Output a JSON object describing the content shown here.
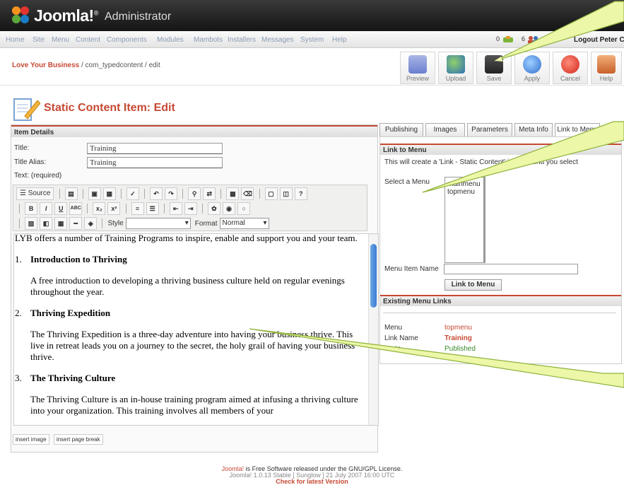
{
  "header": {
    "brand": "Joomla!",
    "sup": "®",
    "admin": "Administrator"
  },
  "menu": [
    "Home",
    "Site",
    "Menu",
    "Content",
    "Components",
    "Modules",
    "Mambots",
    "Installers",
    "Messages",
    "System",
    "Help"
  ],
  "status": {
    "messages": "0",
    "users": "6",
    "logout": "Logout Peter Coo"
  },
  "breadcrumb": {
    "site": "Love Your Business",
    "path": " / com_typedcontent / edit"
  },
  "toolbar": [
    "Preview",
    "Upload",
    "Save",
    "Apply",
    "Cancel",
    "Help"
  ],
  "page": {
    "title": "Static Content Item: Edit"
  },
  "details": {
    "heading": "Item Details",
    "title_label": "Title:",
    "title_value": "Training",
    "alias_label": "Title Alias:",
    "alias_value": "Training",
    "text_label": "Text: (required)"
  },
  "editor_toolbar": {
    "source": "Source",
    "style_label": "Style",
    "format_label": "Format",
    "format_value": "Normal"
  },
  "content": {
    "intro": "LYB offers a number of Training Programs to inspire, enable and support you and your team.",
    "items": [
      {
        "num": "1.",
        "title": "Introduction to Thriving",
        "desc": "A free introduction to developing a thriving business culture held on regular evenings throughout the year."
      },
      {
        "num": "2.",
        "title": "Thriving Expedition",
        "desc": "The Thriving Expedition is a three-day adventure into having your business thrive. This live in retreat leads you on a journey to the secret, the holy grail of having your business thrive."
      },
      {
        "num": "3.",
        "title": "The Thriving Culture",
        "desc": "The Thriving Culture is an in-house training program aimed at infusing a thriving culture into your organization. This training involves all members of your"
      }
    ]
  },
  "insert": {
    "image": "insert image",
    "pagebreak": "insert page break"
  },
  "tabs": [
    "Publishing",
    "Images",
    "Parameters",
    "Meta Info",
    "Link to Menu"
  ],
  "link_menu": {
    "heading": "Link to Menu",
    "desc": "This will create a 'Link - Static Content' in the menu you select",
    "select_label": "Select a Menu",
    "options": [
      "mainmenu",
      "topmenu"
    ],
    "name_label": "Menu Item Name",
    "button": "Link to Menu"
  },
  "existing": {
    "heading": "Existing Menu Links",
    "menu_label": "Menu",
    "menu_value": "topmenu",
    "link_label": "Link Name",
    "link_value": "Training",
    "state_label": "State",
    "state_value": "Published"
  },
  "footer": {
    "joomla": "Joomla!",
    "license": " is Free Software released under the GNU/GPL License.",
    "version": "Joomla! 1.0.13 Stable [ Sunglow ] 21 July 2007 16:00 UTC",
    "check": "Check for latest Version"
  },
  "colors": {
    "accent": "#c64934",
    "header": "#1f1f1f",
    "callout": "#ecf7a8",
    "link": "#c64934",
    "published": "#3a8a2a"
  }
}
